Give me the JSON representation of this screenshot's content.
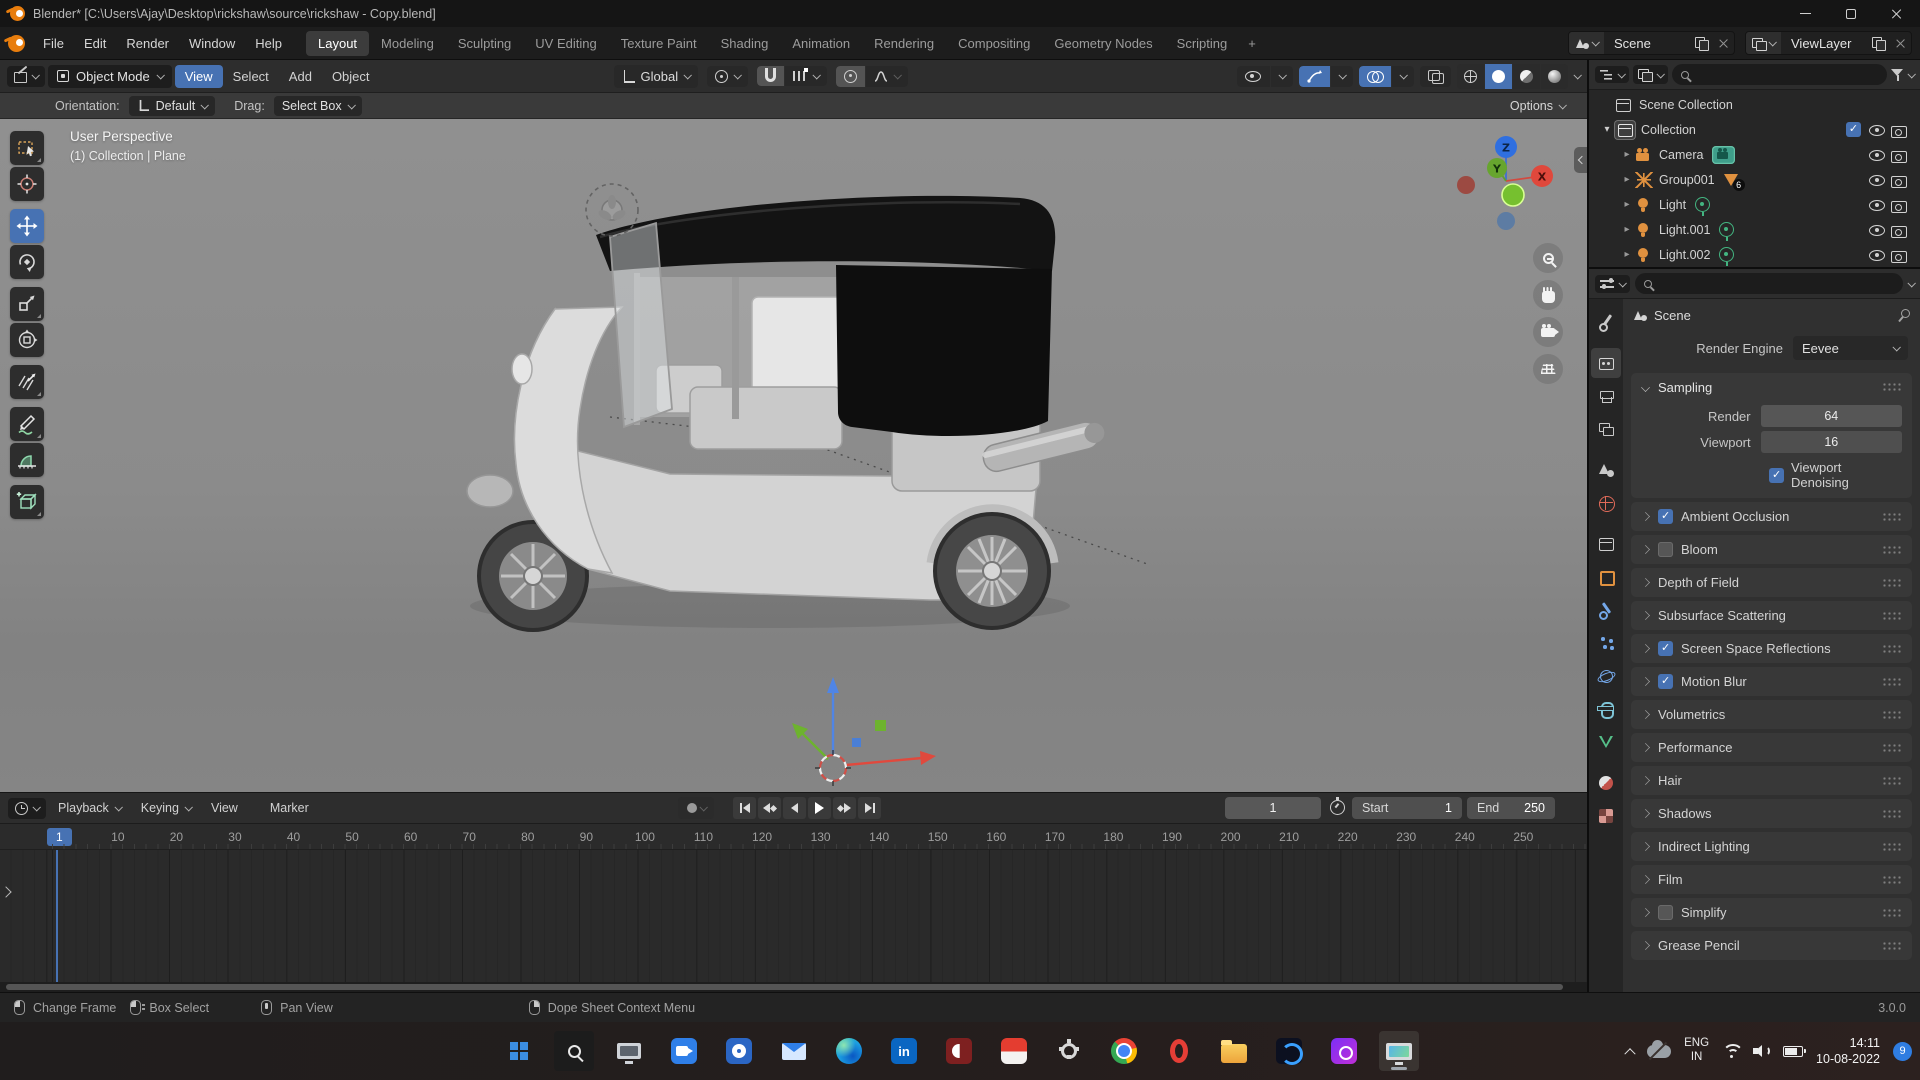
{
  "window": {
    "title": "Blender* [C:\\Users\\Ajay\\Desktop\\rickshaw\\source\\rickshaw - Copy.blend]"
  },
  "topbar": {
    "menus": [
      "File",
      "Edit",
      "Render",
      "Window",
      "Help"
    ],
    "workspaces": [
      {
        "label": "Layout",
        "active": true
      },
      {
        "label": "Modeling"
      },
      {
        "label": "Sculpting"
      },
      {
        "label": "UV Editing"
      },
      {
        "label": "Texture Paint"
      },
      {
        "label": "Shading"
      },
      {
        "label": "Animation"
      },
      {
        "label": "Rendering"
      },
      {
        "label": "Compositing"
      },
      {
        "label": "Geometry Nodes"
      },
      {
        "label": "Scripting"
      }
    ],
    "add_workspace_label": "+",
    "scene_value": "Scene",
    "viewlayer_value": "ViewLayer"
  },
  "viewport_header": {
    "mode_value": "Object Mode",
    "menus": [
      {
        "label": "View",
        "active": true
      },
      {
        "label": "Select"
      },
      {
        "label": "Add"
      },
      {
        "label": "Object"
      }
    ],
    "transform_value": "Global"
  },
  "tool_settings": {
    "orientation_label": "Orientation:",
    "orientation_value": "Default",
    "drag_label": "Drag:",
    "drag_value": "Select Box",
    "options_label": "Options"
  },
  "toolbar": {
    "tools": [
      "select-box",
      "cursor",
      "move",
      "rotate",
      "scale",
      "transform",
      "annotate-lines",
      "annotate-draw",
      "measure",
      "add-cube"
    ],
    "active_tool": "move"
  },
  "viewport": {
    "overlay_line1": "User Perspective",
    "overlay_line2": "(1) Collection | Plane",
    "axis_x": "X",
    "axis_y": "Y",
    "axis_z": "Z"
  },
  "outliner": {
    "rows": [
      {
        "label": "Scene Collection",
        "icon": "box",
        "ind": "i0",
        "exp": "none"
      },
      {
        "label": "Collection",
        "icon": "boxa",
        "ind": "i1",
        "exp": "down",
        "cb": true,
        "eye": true,
        "cam": true
      },
      {
        "label": "Camera",
        "icon": "cam",
        "ind": "i2",
        "exp": "right",
        "chip": "camdata",
        "eye": true,
        "cam": true
      },
      {
        "label": "Group001",
        "icon": "empty",
        "ind": "i2",
        "exp": "right",
        "chip": "mesh",
        "badge": "6",
        "eye": true,
        "cam": true
      },
      {
        "label": "Light",
        "icon": "light",
        "ind": "i2",
        "exp": "right",
        "chip": "lightdata",
        "eye": true,
        "cam": true
      },
      {
        "label": "Light.001",
        "icon": "light",
        "ind": "i2",
        "exp": "right",
        "chip": "lightdata",
        "eye": true,
        "cam": true
      },
      {
        "label": "Light.002",
        "icon": "light",
        "ind": "i2",
        "exp": "right",
        "chip": "lightdata",
        "eye": true,
        "cam": true
      }
    ]
  },
  "properties": {
    "tabs": [
      {
        "name": "tool"
      },
      {
        "name": "render",
        "active": true,
        "gap": true
      },
      {
        "name": "output"
      },
      {
        "name": "viewlayer"
      },
      {
        "name": "scene",
        "gap": true
      },
      {
        "name": "world"
      },
      {
        "name": "collection",
        "gap": true
      },
      {
        "name": "object"
      },
      {
        "name": "modifiers"
      },
      {
        "name": "particles"
      },
      {
        "name": "physics"
      },
      {
        "name": "constraints"
      },
      {
        "name": "data"
      },
      {
        "name": "material",
        "gap": true
      },
      {
        "name": "texture"
      }
    ],
    "breadcrumb": "Scene",
    "render_engine_label": "Render Engine",
    "render_engine_value": "Eevee",
    "sampling": {
      "title": "Sampling",
      "render_label": "Render",
      "render_value": "64",
      "viewport_label": "Viewport",
      "viewport_value": "16",
      "denoising_label": "Viewport Denoising",
      "denoising_checked": true
    },
    "panels": [
      {
        "label": "Ambient Occlusion",
        "has_cb": true,
        "checked": true
      },
      {
        "label": "Bloom",
        "has_cb": true
      },
      {
        "label": "Depth of Field"
      },
      {
        "label": "Subsurface Scattering"
      },
      {
        "label": "Screen Space Reflections",
        "has_cb": true,
        "checked": true
      },
      {
        "label": "Motion Blur",
        "has_cb": true,
        "checked": true
      },
      {
        "label": "Volumetrics"
      },
      {
        "label": "Performance"
      },
      {
        "label": "Hair"
      },
      {
        "label": "Shadows"
      },
      {
        "label": "Indirect Lighting"
      },
      {
        "label": "Film"
      },
      {
        "label": "Simplify",
        "has_cb": true
      },
      {
        "label": "Grease Pencil"
      }
    ]
  },
  "timeline": {
    "menus": [
      {
        "label": "Playback",
        "dd": true
      },
      {
        "label": "Keying",
        "dd": true
      },
      {
        "label": "View"
      },
      {
        "label": "Marker"
      }
    ],
    "ruler": [
      {
        "v": "1",
        "current": true
      },
      {
        "v": "10"
      },
      {
        "v": "20"
      },
      {
        "v": "30"
      },
      {
        "v": "40"
      },
      {
        "v": "50"
      },
      {
        "v": "60"
      },
      {
        "v": "70"
      },
      {
        "v": "80"
      },
      {
        "v": "90"
      },
      {
        "v": "100"
      },
      {
        "v": "110"
      },
      {
        "v": "120"
      },
      {
        "v": "130"
      },
      {
        "v": "140"
      },
      {
        "v": "150"
      },
      {
        "v": "160"
      },
      {
        "v": "170"
      },
      {
        "v": "180"
      },
      {
        "v": "190"
      },
      {
        "v": "200"
      },
      {
        "v": "210"
      },
      {
        "v": "220"
      },
      {
        "v": "230"
      },
      {
        "v": "240"
      },
      {
        "v": "250"
      }
    ],
    "current_frame": "1",
    "start_label": "Start",
    "start_value": "1",
    "end_label": "End",
    "end_value": "250"
  },
  "statusbar": {
    "hints": [
      {
        "label": "Change Frame",
        "btn": "l"
      },
      {
        "label": "Box Select",
        "btn": "ld"
      },
      {
        "label": "Pan View",
        "btn": "m"
      },
      {
        "label": "Dope Sheet Context Menu",
        "btn": "r"
      }
    ],
    "version": "3.0.0"
  },
  "taskbar": {
    "icons": [
      {
        "name": "start-icon",
        "cls": "start"
      },
      {
        "name": "search-icon",
        "cls": "search"
      },
      {
        "name": "monitor-app-icon",
        "cls": "monitor"
      },
      {
        "name": "camera-app-icon",
        "cls": "camapp"
      },
      {
        "name": "media-app-icon",
        "cls": "media"
      },
      {
        "name": "mail-app-icon",
        "cls": "mail"
      },
      {
        "name": "edge-browser-icon",
        "cls": "edge"
      },
      {
        "name": "linkedin-icon",
        "cls": "linkedin",
        "glyph": "in"
      },
      {
        "name": "maroon-app-icon",
        "cls": "maroon"
      },
      {
        "name": "red-app-icon",
        "cls": "redapp"
      },
      {
        "name": "settings-gear-icon",
        "cls": "gear"
      },
      {
        "name": "chrome-browser-icon",
        "cls": "chrome"
      },
      {
        "name": "opera-browser-icon",
        "cls": "opera"
      },
      {
        "name": "file-explorer-icon",
        "cls": "folder"
      },
      {
        "name": "dark-app-icon",
        "cls": "darkapp"
      },
      {
        "name": "purple-app-icon",
        "cls": "purple"
      },
      {
        "name": "screen-capture-app-icon",
        "cls": "capture",
        "active": true
      }
    ],
    "tray": {
      "language_line1": "ENG",
      "language_line2": "IN",
      "time": "14:11",
      "date": "10-08-2022",
      "badge": "9"
    }
  }
}
